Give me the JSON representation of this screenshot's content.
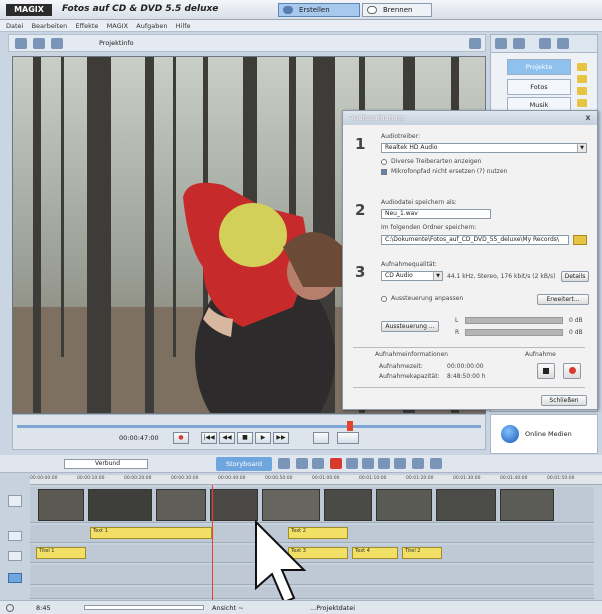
{
  "app": {
    "logo": "MAGIX",
    "title": "Fotos auf CD & DVD 5.5 deluxe",
    "mode_buttons": [
      "Erstellen",
      "Brennen"
    ]
  },
  "menu": [
    "Datei",
    "Bearbeiten",
    "Effekte",
    "MAGIX",
    "Aufgaben",
    "Hilfe"
  ],
  "toolbar": {
    "project_label": "Projektinfo"
  },
  "right_panel": {
    "tabs": [
      "Projekte",
      "Fotos",
      "Musik"
    ]
  },
  "online_button": {
    "label": "Online Medien"
  },
  "dialog": {
    "title": "Audioaufnahme",
    "close_label": "x",
    "step1": {
      "num": "1",
      "label": "Audiotreiber:",
      "driver_value": "Realtek HD Audio",
      "opt1": "Diverse Treiberarten anzeigen",
      "opt2": "Mikrofonpfad nicht ersetzen (?) nutzen"
    },
    "step2": {
      "num": "2",
      "label": "Audiodatei speichern als:",
      "filename": "Neu_1.wav",
      "path_label": "Im folgenden Ordner speichern:",
      "path": "C:\\Dokumente\\Fotos_auf_CD_DVD_55_deluxe\\My Records\\"
    },
    "step3": {
      "num": "3",
      "label": "Aufnahmequalität:",
      "quality_value": "CD Audio",
      "quality_info": "44.1 kHz, Stereo, 176 kbit/s (2 kB/s)",
      "quality_btn": "Details",
      "auto_opt": "Aussteuerung anpassen",
      "settings_btn": "Erweitert...",
      "level_btn": "Aussteuerung ...",
      "meter_l": "L",
      "meter_r": "R",
      "db_l": "0 dB",
      "db_r": "0 dB"
    },
    "info_label": "Aufnahmeinformationen",
    "record_label": "Aufnahme",
    "time_label": "Aufnahmezeit:",
    "time_value": "00:00:00:00",
    "remaining_label": "Aufnahmekapazität:",
    "remaining_value": "8:48:50:00 h",
    "close_btn": "Schließen"
  },
  "transport": {
    "timecode": "00:00:47:00",
    "buttons": [
      "●",
      "|◀◀",
      "◀◀",
      "■",
      "▶",
      "▶▶"
    ]
  },
  "timeline": {
    "mode_label": "Storyboard",
    "mode_select": "Verbund",
    "ruler": [
      "00:00:00:00",
      "00:00:10:00",
      "00:00:20:00",
      "00:00:30:00",
      "00:00:40:00",
      "00:00:50:00",
      "00:01:00:00",
      "00:01:10:00",
      "00:01:20:00",
      "00:01:30:00",
      "00:01:40:00",
      "00:01:50:00"
    ],
    "text_clips": [
      "Text 1",
      "Text 2",
      "Titel 1",
      "Text 3",
      "Text 4",
      "Titel 2"
    ]
  },
  "status": {
    "left": "8:45",
    "zoom": "Ansicht ~",
    "right": "...Projektdatei"
  },
  "colors": {
    "accent": "#5a7db0",
    "clip_yellow": "#f1df66",
    "playhead": "#e2432a",
    "record": "#d83a2e"
  }
}
